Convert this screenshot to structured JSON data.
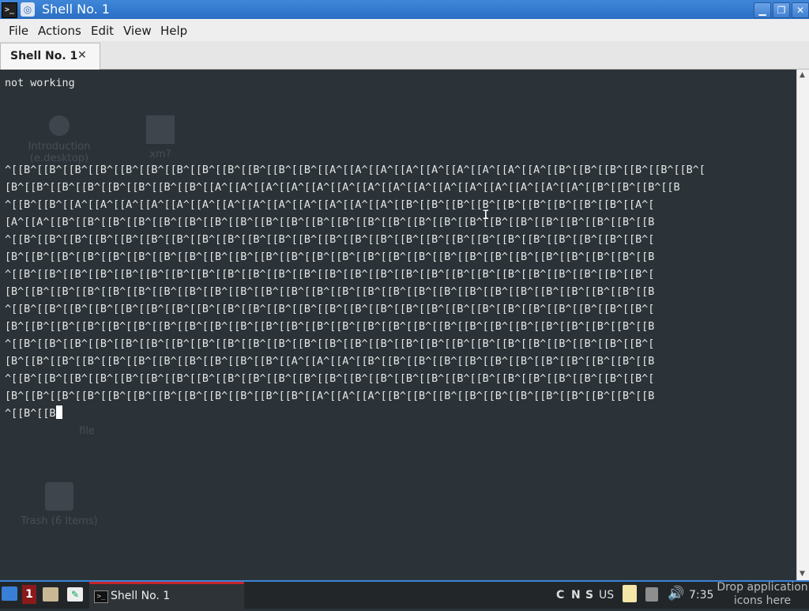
{
  "window": {
    "title": "Shell No. 1",
    "app_icon": ">_",
    "pin_icon": "◎",
    "buttons": {
      "minimize": "▁",
      "maximize": "❐",
      "close": "✕"
    }
  },
  "menu": [
    "File",
    "Actions",
    "Edit",
    "View",
    "Help"
  ],
  "tabs": [
    {
      "label": "Shell No. 1",
      "close": "✕"
    }
  ],
  "terminal": {
    "first_line": "not working",
    "cursor_prefix": "^[[B^[[B"
  },
  "desktop_ghosts": {
    "intro_label": "Introduction",
    "intro_sub": "(e.desktop)",
    "xfile_label": "xm?",
    "file_label": "file",
    "trash_label": "Trash (6 Items)"
  },
  "taskbar": {
    "workspace": "1",
    "task_label": "Shell No. 1",
    "tray_c": "C",
    "tray_n": "N",
    "tray_s": "S",
    "layout": "US",
    "volume_icon": "🔊",
    "clock": "7:35",
    "drop_text": "Drop application icons here"
  }
}
